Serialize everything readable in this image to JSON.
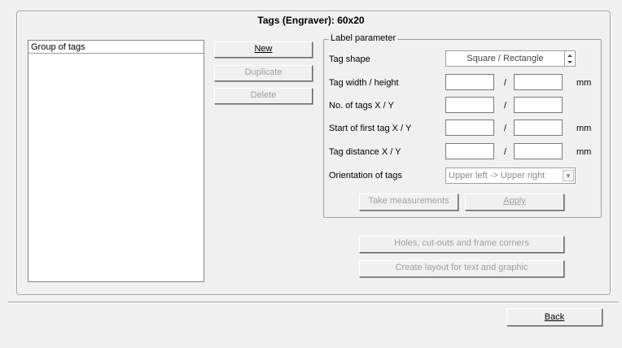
{
  "window": {
    "title": "Tags (Engraver): 60x20"
  },
  "list": {
    "header": "Group of tags"
  },
  "buttons": {
    "new": "New",
    "duplicate": "Duplicate",
    "delete": "Delete",
    "take_measurements": "Take measurements",
    "apply": "Apply",
    "holes": "Holes, cut-outs and frame corners",
    "layout": "Create layout for text and graphic",
    "back": "Back"
  },
  "label_parameter": {
    "legend": "Label parameter",
    "tag_shape": {
      "label": "Tag shape",
      "value": "Square / Rectangle"
    },
    "tag_size": {
      "label": "Tag width / height",
      "unit": "mm"
    },
    "tag_count": {
      "label": "No. of tags X / Y"
    },
    "start": {
      "label": "Start of first tag X / Y",
      "unit": "mm"
    },
    "distance": {
      "label": "Tag distance  X / Y",
      "unit": "mm"
    },
    "orientation": {
      "label": "Orientation of tags",
      "value": "Upper left -> Upper right"
    },
    "slash": "/"
  }
}
